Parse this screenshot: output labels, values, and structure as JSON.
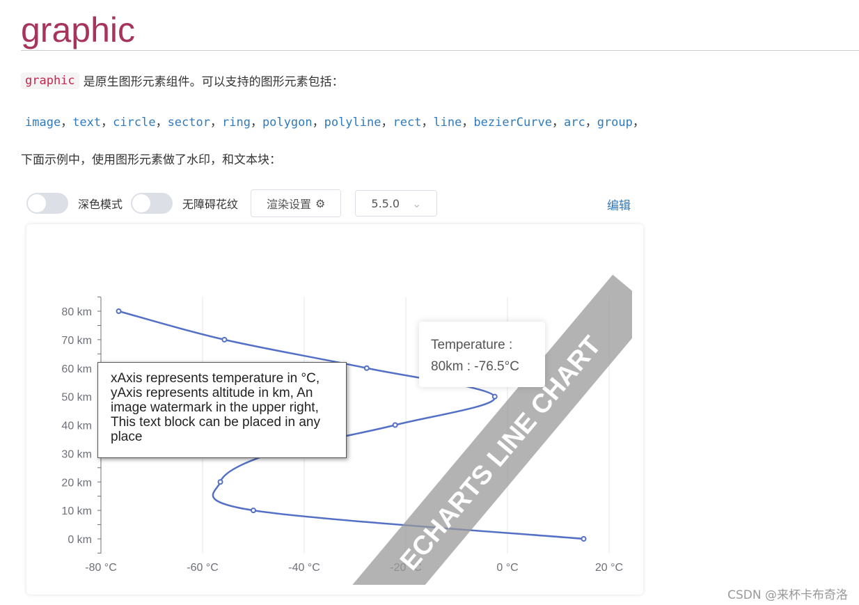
{
  "page": {
    "title": "graphic",
    "intro_code": "graphic",
    "intro_text": "是原生图形元素组件。可以支持的图形元素包括：",
    "elements": [
      "image",
      "text",
      "circle",
      "sector",
      "ring",
      "polygon",
      "polyline",
      "rect",
      "line",
      "bezierCurve",
      "arc",
      "group"
    ],
    "example_text": "下面示例中，使用图形元素做了水印，和文本块："
  },
  "toolbar": {
    "dark_mode_label": "深色模式",
    "dark_mode_on": false,
    "aria_label": "无障碍花纹",
    "aria_on": false,
    "render_settings_label": "渲染设置",
    "version": "5.5.0",
    "edit_label": "编辑"
  },
  "chart_data": {
    "type": "line",
    "series": [
      {
        "name": "Temperature",
        "x": [
          15,
          -50,
          -56.5,
          -46.5,
          -22.1,
          -2.5,
          -27.7,
          -55.7,
          -76.5
        ],
        "y": [
          0,
          10,
          20,
          30,
          40,
          50,
          60,
          70,
          80
        ]
      }
    ],
    "x_ticks": [
      "-80 °C",
      "-60 °C",
      "-40 °C",
      "-20 °C",
      "0 °C",
      "20 °C"
    ],
    "xlim": [
      -80,
      20
    ],
    "y_ticks": [
      "0 km",
      "10 km",
      "20 km",
      "30 km",
      "40 km",
      "50 km",
      "60 km",
      "70 km",
      "80 km"
    ],
    "ylim": [
      0,
      80
    ],
    "smooth": true,
    "grid": "vertical",
    "line_color": "#5470c6",
    "tooltip": {
      "title": "Temperature :",
      "value": "80km : -76.5°C"
    },
    "text_block": "xAxis represents temperature in °C, yAxis represents altitude in km, An image watermark in the upper right, This text block can be placed in any place",
    "watermark": "ECHARTS LINE CHART"
  },
  "footer": {
    "credit": "CSDN @来杯卡布奇洛"
  }
}
